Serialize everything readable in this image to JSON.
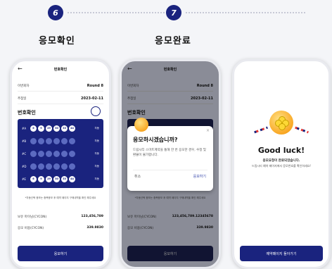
{
  "steps": [
    {
      "number": "6",
      "title": "응모확인"
    },
    {
      "number": "7",
      "title": "응모완료"
    }
  ],
  "screen1": {
    "header": "번호확인",
    "fields": [
      {
        "label": "이번회차",
        "value": "Round 8"
      },
      {
        "label": "추첨일",
        "value": "2023-02-11"
      }
    ],
    "section_title": "번호확인",
    "rows": [
      {
        "label": "#A",
        "balls": [
          "6",
          "9",
          "29",
          "30",
          "33",
          "44"
        ],
        "action": "자동"
      },
      {
        "label": "#B",
        "balls": [
          "",
          "",
          "",
          "",
          "",
          ""
        ],
        "action": "자동"
      },
      {
        "label": "#C",
        "balls": [
          "",
          "",
          "",
          "",
          "",
          ""
        ],
        "action": "자동"
      },
      {
        "label": "#D",
        "balls": [
          "",
          "",
          "",
          "",
          "",
          ""
        ],
        "action": "자동"
      },
      {
        "label": "#E",
        "balls": [
          "6",
          "9",
          "29",
          "30",
          "33",
          "44"
        ],
        "action": "자동"
      }
    ],
    "note": "*자동선택 응모는 중복응모 후 예약 페이지 구매내역을 확인 해주세요",
    "summary": [
      {
        "label": "보유 마이닝(CYCON)",
        "value": "123,456,789"
      },
      {
        "label": "응모 비용(CYCON)",
        "value": "339.9830"
      }
    ],
    "button": "응모하기"
  },
  "screen2": {
    "header": "번호확인",
    "fields": [
      {
        "label": "이번회차",
        "value": "Round 8"
      },
      {
        "label": "추첨일",
        "value": "2023-02-11"
      }
    ],
    "section_title": "번호확인",
    "modal": {
      "title": "응모하시겠습니까?",
      "body": "드림시티 스마트계약을 통해 한 번 응모한 경우, 수정 및 환불이 불가합니다.",
      "cancel": "취소",
      "confirm": "응모하기"
    },
    "note": "*자동선택 응모는 중복응모 후 예약 페이지 구매내역을 확인 해주세요",
    "summary": [
      {
        "label": "보유 마이닝(CYCON)",
        "value": "123,456,789.12345678"
      },
      {
        "label": "응모 비용(CYCON)",
        "value": "339.9830"
      }
    ],
    "button": "응모하기"
  },
  "screen3": {
    "title": "Good luck!",
    "subtitle": "응모요청이 완료되었습니다.",
    "subtitle2": "드림시티 예약 페이지에서 응모번호를 확인하세요!",
    "button": "예약페이지 돌아가기"
  },
  "colors": {
    "primary": "#1a237e",
    "gold": "#f9a825",
    "background": "#f4f5f8"
  }
}
